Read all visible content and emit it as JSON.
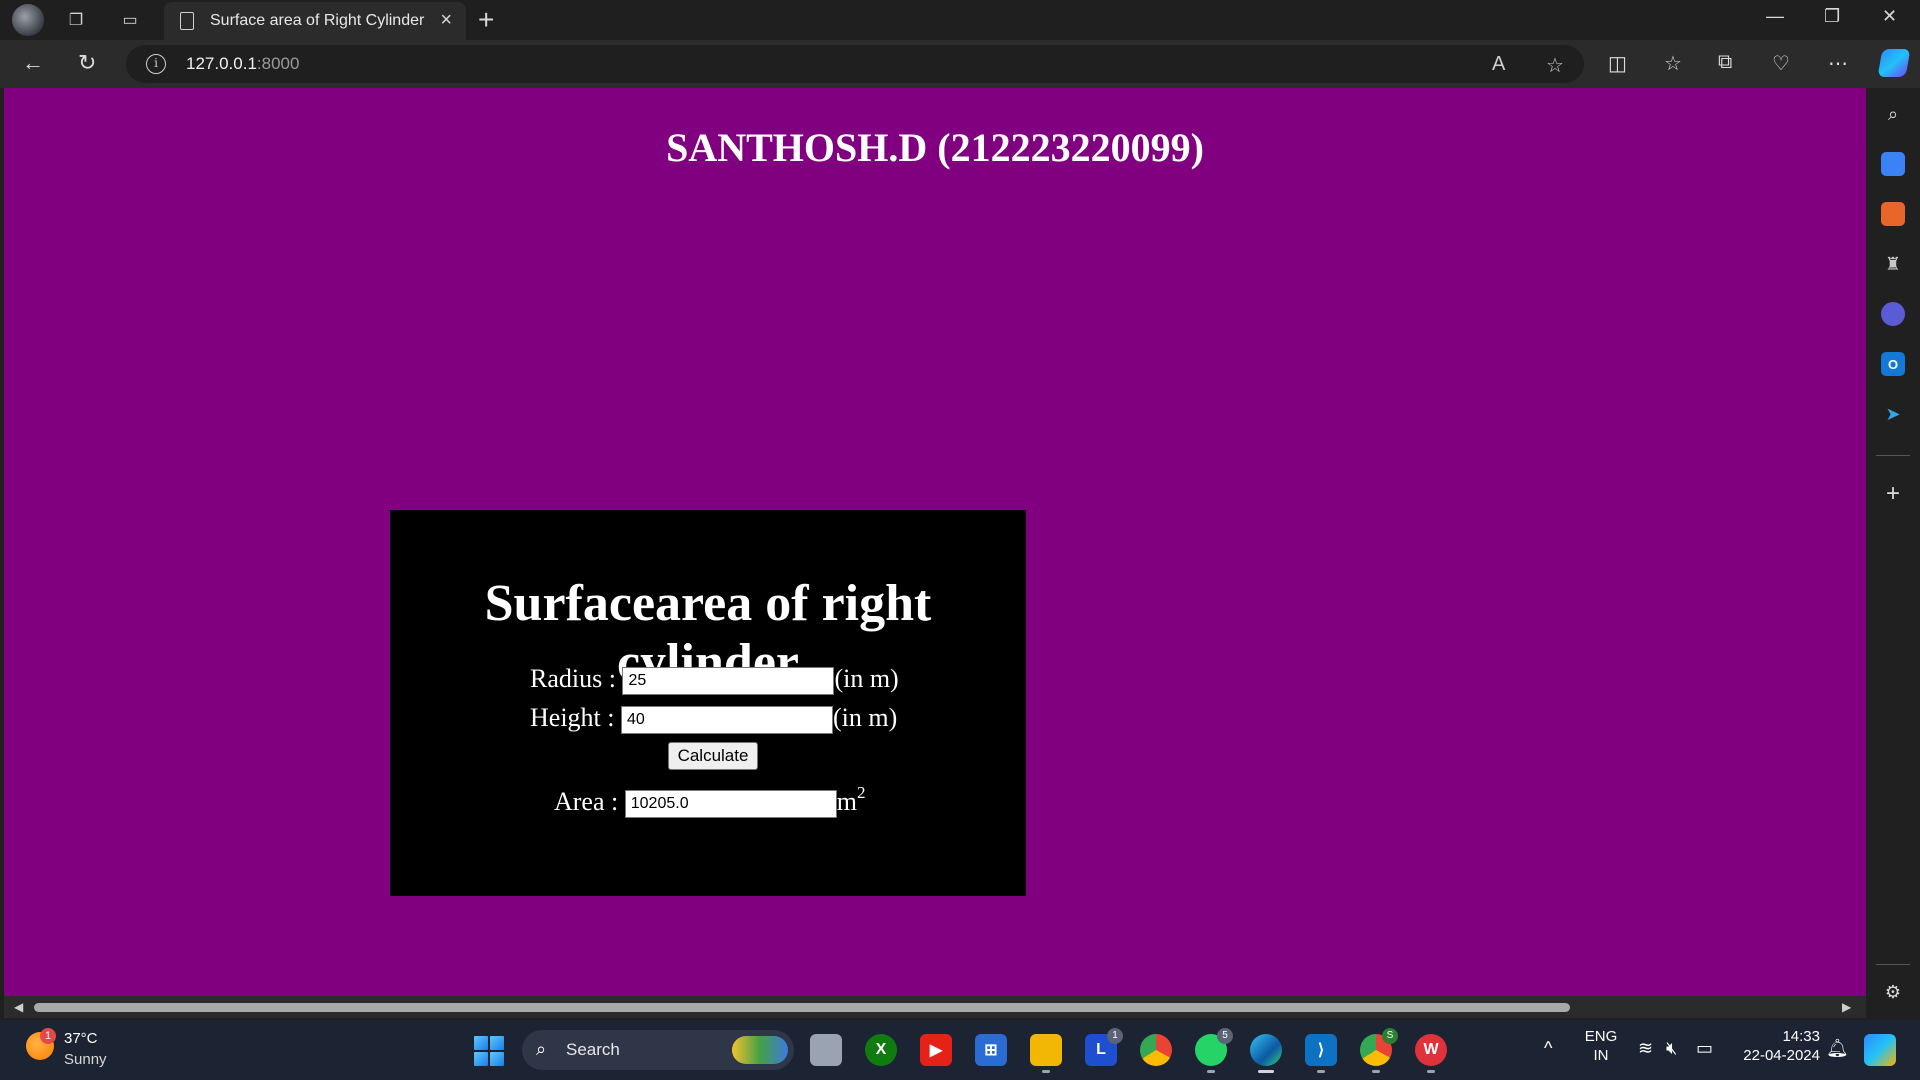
{
  "browser": {
    "tab_title": "Surface area of Right Cylinder",
    "url_host": "127.0.0.1",
    "url_port": ":8000"
  },
  "page": {
    "student_header": "SANTHOSH.D (212223220099)",
    "calc_title": "Surfacearea of right cylinder",
    "radius_label": "Radius :",
    "radius_value": "25",
    "radius_unit": "(in m)",
    "height_label": "Height :",
    "height_value": "40",
    "height_unit": "(in m)",
    "calculate_label": "Calculate",
    "area_label": "Area :",
    "area_value": "10205.0",
    "area_unit": "m",
    "area_unit_exp": "2"
  },
  "taskbar": {
    "weather_temp": "37°C",
    "weather_desc": "Sunny",
    "weather_badge": "1",
    "search_label": "Search",
    "lang_top": "ENG",
    "lang_bottom": "IN",
    "time": "14:33",
    "date": "22-04-2024",
    "badge_lens": "1",
    "badge_whatsapp": "5",
    "badge_chrome": "S"
  },
  "colors": {
    "page_background": "#800080",
    "calc_box_background": "#000000"
  }
}
